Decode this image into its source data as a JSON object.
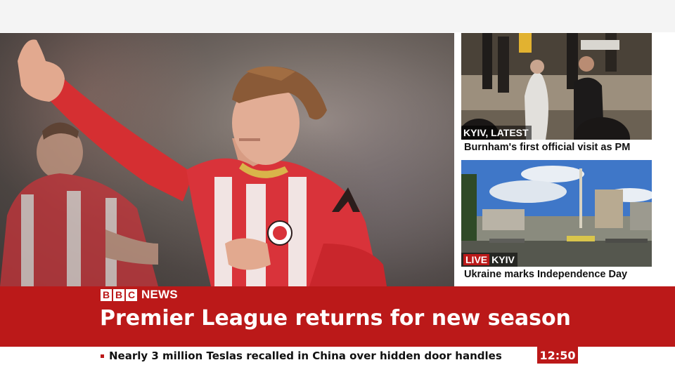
{
  "main_story": {
    "headline": "Premier League returns for new season"
  },
  "branding": {
    "letters": [
      "B",
      "B",
      "C"
    ],
    "news_label": "NEWS"
  },
  "side_stories": [
    {
      "tag_live": "",
      "tag": "KYIV, LATEST",
      "caption": "Burnham's first official visit as PM"
    },
    {
      "tag_live": "LIVE",
      "tag": "KYIV",
      "caption": "Ukraine marks Independence Day"
    }
  ],
  "ticker": {
    "text": "Nearly 3 million Teslas recalled in China over hidden door handles"
  },
  "clock": "12:50",
  "colors": {
    "bbc_red": "#bb1919",
    "text_dark": "#111111",
    "background": "#ffffff"
  }
}
